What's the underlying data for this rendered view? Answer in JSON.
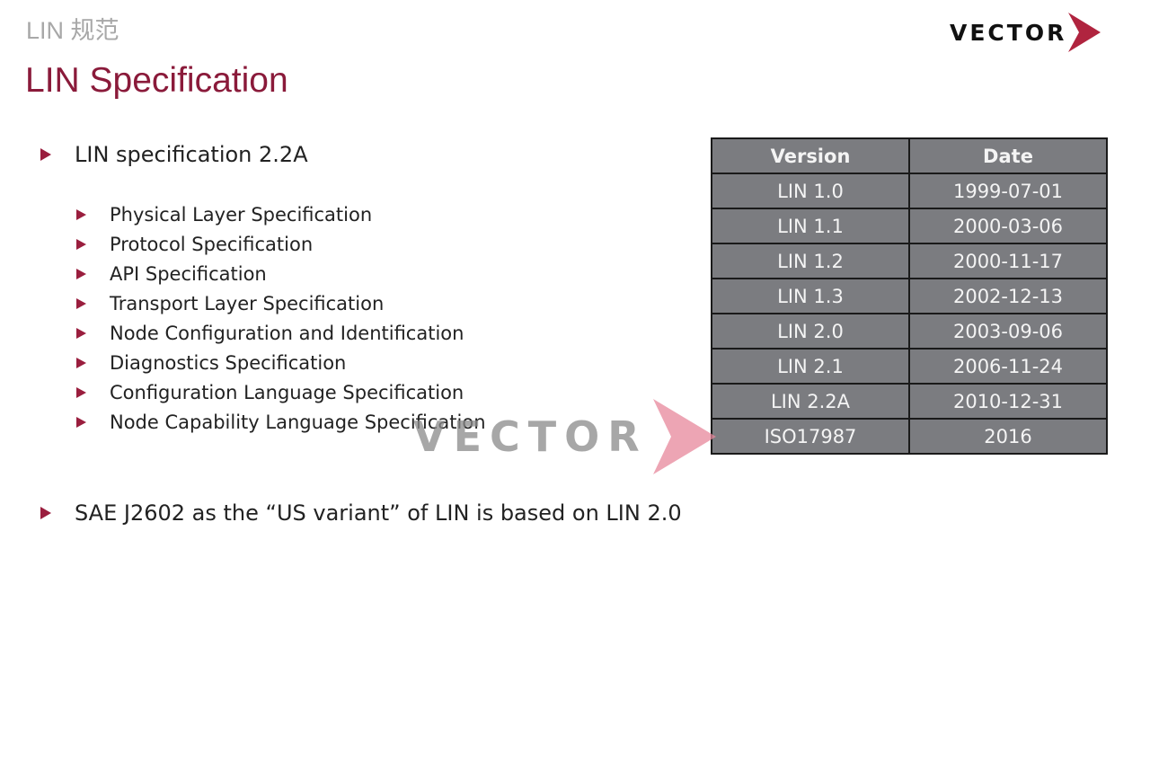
{
  "header": {
    "subtitle": "LIN 规范",
    "title": "LIN Specification",
    "logo_text": "VECTOR"
  },
  "colors": {
    "accent": "#8a1a3a",
    "bullet": "#9a1e3e",
    "table_bg": "#7b7c80"
  },
  "main": {
    "bullet1": "LIN specification 2.2A",
    "subitems": [
      "Physical Layer Specification",
      "Protocol Specification",
      "API Specification",
      "Transport Layer Specification",
      "Node Configuration and Identification",
      "Diagnostics Specification",
      "Configuration Language Specification",
      "Node Capability Language Specification"
    ],
    "bullet2": "SAE J2602 as the “US variant” of LIN is based on LIN 2.0"
  },
  "table": {
    "headers": [
      "Version",
      "Date"
    ],
    "rows": [
      [
        "LIN 1.0",
        "1999-07-01"
      ],
      [
        "LIN 1.1",
        "2000-03-06"
      ],
      [
        "LIN 1.2",
        "2000-11-17"
      ],
      [
        "LIN 1.3",
        "2002-12-13"
      ],
      [
        "LIN 2.0",
        "2003-09-06"
      ],
      [
        "LIN 2.1",
        "2006-11-24"
      ],
      [
        "LIN 2.2A",
        "2010-12-31"
      ],
      [
        "ISO17987",
        "2016"
      ]
    ]
  },
  "watermark": {
    "text": "VECTOR"
  }
}
